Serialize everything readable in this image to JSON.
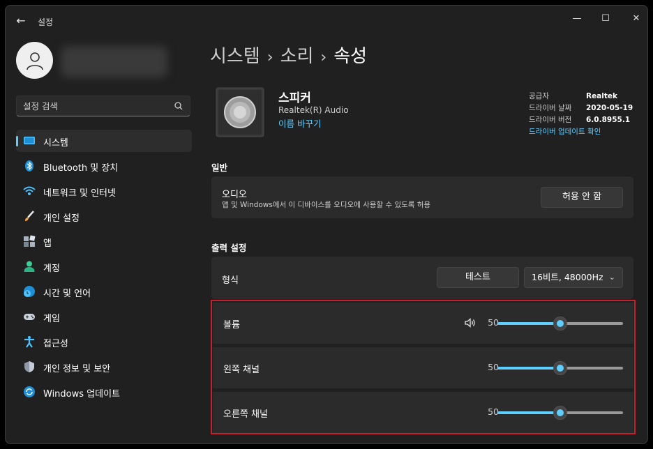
{
  "window": {
    "app_title": "설정",
    "back": "←",
    "minimize": "—",
    "maximize": "☐",
    "close": "✕"
  },
  "sidebar": {
    "search_placeholder": "설정 검색",
    "items": [
      {
        "label": "시스템",
        "icon": "system-icon",
        "active": true
      },
      {
        "label": "Bluetooth 및 장치",
        "icon": "bluetooth-icon"
      },
      {
        "label": "네트워크 및 인터넷",
        "icon": "wifi-icon"
      },
      {
        "label": "개인 설정",
        "icon": "brush-icon"
      },
      {
        "label": "앱",
        "icon": "apps-icon"
      },
      {
        "label": "계정",
        "icon": "account-icon"
      },
      {
        "label": "시간 및 언어",
        "icon": "clock-globe-icon"
      },
      {
        "label": "게임",
        "icon": "gamepad-icon"
      },
      {
        "label": "접근성",
        "icon": "accessibility-icon"
      },
      {
        "label": "개인 정보 및 보안",
        "icon": "shield-icon"
      },
      {
        "label": "Windows 업데이트",
        "icon": "update-icon"
      }
    ]
  },
  "breadcrumb": {
    "level1": "시스템",
    "level2": "소리",
    "current": "속성",
    "separator": "›"
  },
  "device": {
    "name": "스피커",
    "subtitle": "Realtek(R) Audio",
    "rename_link": "이름 바꾸기",
    "info": {
      "vendor_label": "공급자",
      "vendor": "Realtek",
      "date_label": "드라이버 날짜",
      "date": "2020-05-19",
      "version_label": "드라이버 버전",
      "version": "6.0.8955.1",
      "update_link": "드라이버 업데이트 확인"
    }
  },
  "general": {
    "section_title": "일반",
    "audio_title": "오디오",
    "audio_desc": "앱 및 Windows에서 이 디바이스를 오디오에 사용할 수 있도록 허용",
    "audio_button": "허용 안 함"
  },
  "output": {
    "section_title": "출력 설정",
    "format_label": "형식",
    "test_button": "테스트",
    "format_value": "16비트, 48000Hz",
    "volume_label": "볼륨",
    "volume_value": "50",
    "left_label": "왼쪽 채널",
    "left_value": "50",
    "right_label": "오른쪽 채널",
    "right_value": "50"
  },
  "colors": {
    "accent": "#60cdff",
    "highlight_border": "#c5202c",
    "background": "#202020",
    "card": "#2b2b2b"
  }
}
